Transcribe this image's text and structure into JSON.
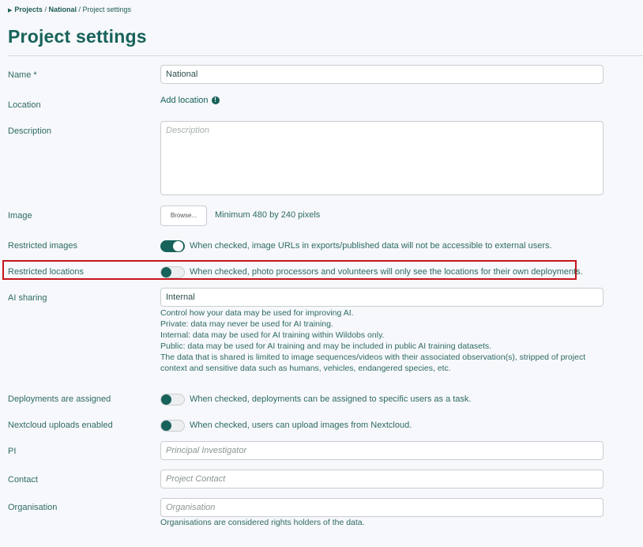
{
  "breadcrumb": {
    "projects": "Projects",
    "sep1": "/",
    "project": "National",
    "sep2": "/",
    "current": "Project settings"
  },
  "page_title": "Project settings",
  "name": {
    "label": "Name *",
    "value": "National"
  },
  "location": {
    "label": "Location",
    "link": "Add location",
    "warn_icon_text": "!"
  },
  "description": {
    "label": "Description",
    "placeholder": "Description"
  },
  "image": {
    "label": "Image",
    "browse_label": "Browse...",
    "hint": "Minimum 480 by 240 pixels"
  },
  "restricted_images": {
    "label": "Restricted images",
    "checked": true,
    "description": "When checked, image URLs in exports/published data will not be accessible to external users."
  },
  "restricted_locations": {
    "label": "Restricted locations",
    "checked": false,
    "description": "When checked, photo processors and volunteers will only see the locations for their own deployments."
  },
  "ai_sharing": {
    "label": "AI sharing",
    "value": "Internal",
    "help_lines": [
      "Control how your data may be used for improving AI.",
      "Private: data may never be used for AI training.",
      "Internal: data may be used for AI training within Wildobs only.",
      "Public: data may be used for AI training and may be included in public AI training datasets.",
      "The data that is shared is limited to image sequences/videos with their associated observation(s), stripped of project",
      "context and sensitive data such as humans, vehicles, endangered species, etc."
    ]
  },
  "deployments_assigned": {
    "label": "Deployments are assigned",
    "checked": false,
    "description": "When checked, deployments can be assigned to specific users as a task."
  },
  "nextcloud": {
    "label": "Nextcloud uploads enabled",
    "checked": false,
    "description": "When checked, users can upload images from Nextcloud."
  },
  "pi": {
    "label": "PI",
    "placeholder": "Principal Investigator"
  },
  "contact": {
    "label": "Contact",
    "placeholder": "Project Contact"
  },
  "organisation": {
    "label": "Organisation",
    "placeholder": "Organisation",
    "hint": "Organisations are considered rights holders of the data."
  },
  "colors": {
    "accent": "#17625a",
    "highlight": "#c4161c"
  }
}
